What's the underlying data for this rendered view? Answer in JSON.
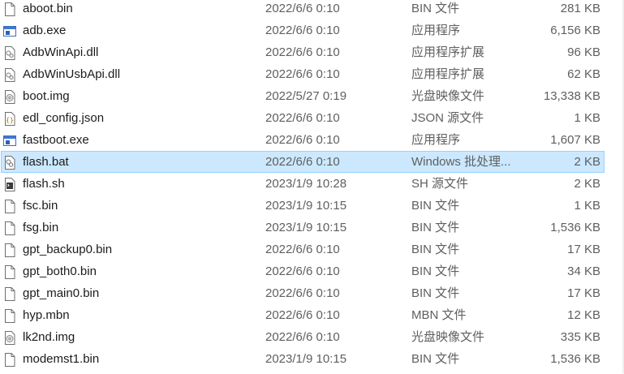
{
  "files": [
    {
      "name": "aboot.bin",
      "date": "2022/6/6 0:10",
      "type": "BIN 文件",
      "size": "281 KB",
      "icon": "blank-file-icon"
    },
    {
      "name": "adb.exe",
      "date": "2022/6/6 0:10",
      "type": "应用程序",
      "size": "6,156 KB",
      "icon": "exe-window-icon"
    },
    {
      "name": "AdbWinApi.dll",
      "date": "2022/6/6 0:10",
      "type": "应用程序扩展",
      "size": "96 KB",
      "icon": "dll-gear-icon"
    },
    {
      "name": "AdbWinUsbApi.dll",
      "date": "2022/6/6 0:10",
      "type": "应用程序扩展",
      "size": "62 KB",
      "icon": "dll-gear-icon"
    },
    {
      "name": "boot.img",
      "date": "2022/5/27 0:19",
      "type": "光盘映像文件",
      "size": "13,338 KB",
      "icon": "disc-image-icon"
    },
    {
      "name": "edl_config.json",
      "date": "2022/6/6 0:10",
      "type": "JSON 源文件",
      "size": "1 KB",
      "icon": "json-braces-icon"
    },
    {
      "name": "fastboot.exe",
      "date": "2022/6/6 0:10",
      "type": "应用程序",
      "size": "1,607 KB",
      "icon": "exe-window-icon"
    },
    {
      "name": "flash.bat",
      "date": "2022/6/6 0:10",
      "type": "Windows 批处理...",
      "size": "2 KB",
      "icon": "batch-gear-icon",
      "selected": true
    },
    {
      "name": "flash.sh",
      "date": "2023/1/9 10:28",
      "type": "SH 源文件",
      "size": "2 KB",
      "icon": "script-terminal-icon"
    },
    {
      "name": "fsc.bin",
      "date": "2023/1/9 10:15",
      "type": "BIN 文件",
      "size": "1 KB",
      "icon": "blank-file-icon"
    },
    {
      "name": "fsg.bin",
      "date": "2023/1/9 10:15",
      "type": "BIN 文件",
      "size": "1,536 KB",
      "icon": "blank-file-icon"
    },
    {
      "name": "gpt_backup0.bin",
      "date": "2022/6/6 0:10",
      "type": "BIN 文件",
      "size": "17 KB",
      "icon": "blank-file-icon"
    },
    {
      "name": "gpt_both0.bin",
      "date": "2022/6/6 0:10",
      "type": "BIN 文件",
      "size": "34 KB",
      "icon": "blank-file-icon"
    },
    {
      "name": "gpt_main0.bin",
      "date": "2022/6/6 0:10",
      "type": "BIN 文件",
      "size": "17 KB",
      "icon": "blank-file-icon"
    },
    {
      "name": "hyp.mbn",
      "date": "2022/6/6 0:10",
      "type": "MBN 文件",
      "size": "12 KB",
      "icon": "blank-file-icon"
    },
    {
      "name": "lk2nd.img",
      "date": "2022/6/6 0:10",
      "type": "光盘映像文件",
      "size": "335 KB",
      "icon": "disc-image-icon"
    },
    {
      "name": "modemst1.bin",
      "date": "2023/1/9 10:15",
      "type": "BIN 文件",
      "size": "1,536 KB",
      "icon": "blank-file-icon"
    }
  ],
  "colors": {
    "selection_fill": "#cce8ff",
    "selection_border": "#99d1ff",
    "exe_blue": "#1f5fb8"
  }
}
